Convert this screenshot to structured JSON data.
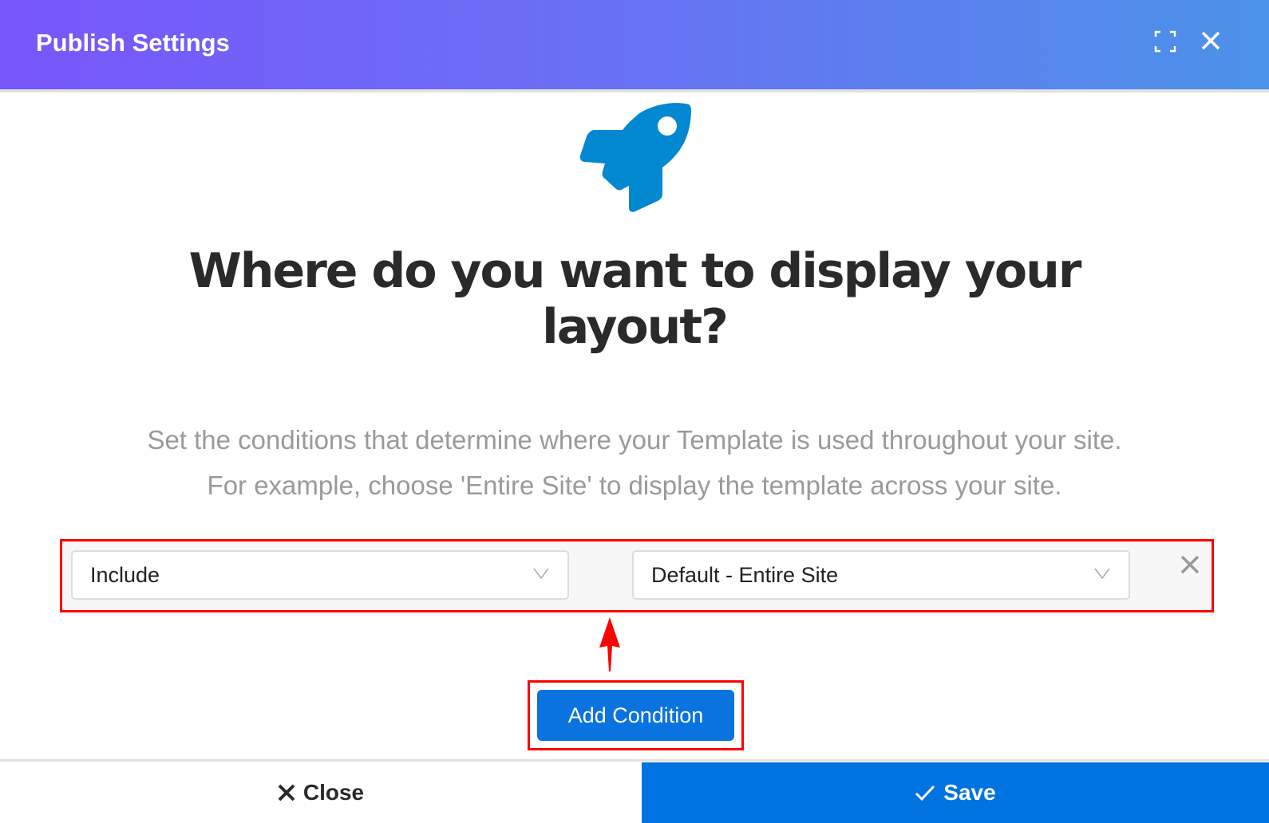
{
  "header": {
    "title": "Publish Settings",
    "icons": [
      "fullscreen-icon",
      "close-icon"
    ]
  },
  "main": {
    "icon": "rocket-icon",
    "heading_line1": "Where do you want to display your",
    "heading_line2": "layout?",
    "description_line1": "Set the conditions that determine where your Template is used throughout your site.",
    "description_line2": "For example, choose 'Entire Site' to display the template across your site.",
    "condition": {
      "type_value": "Include",
      "target_value": "Default - Entire Site"
    },
    "add_condition_label": "Add Condition"
  },
  "footer": {
    "close_label": "Close",
    "save_label": "Save"
  },
  "colors": {
    "accent": "#0073e0",
    "rocket": "#0288d1",
    "annotation": "#ff0000"
  }
}
